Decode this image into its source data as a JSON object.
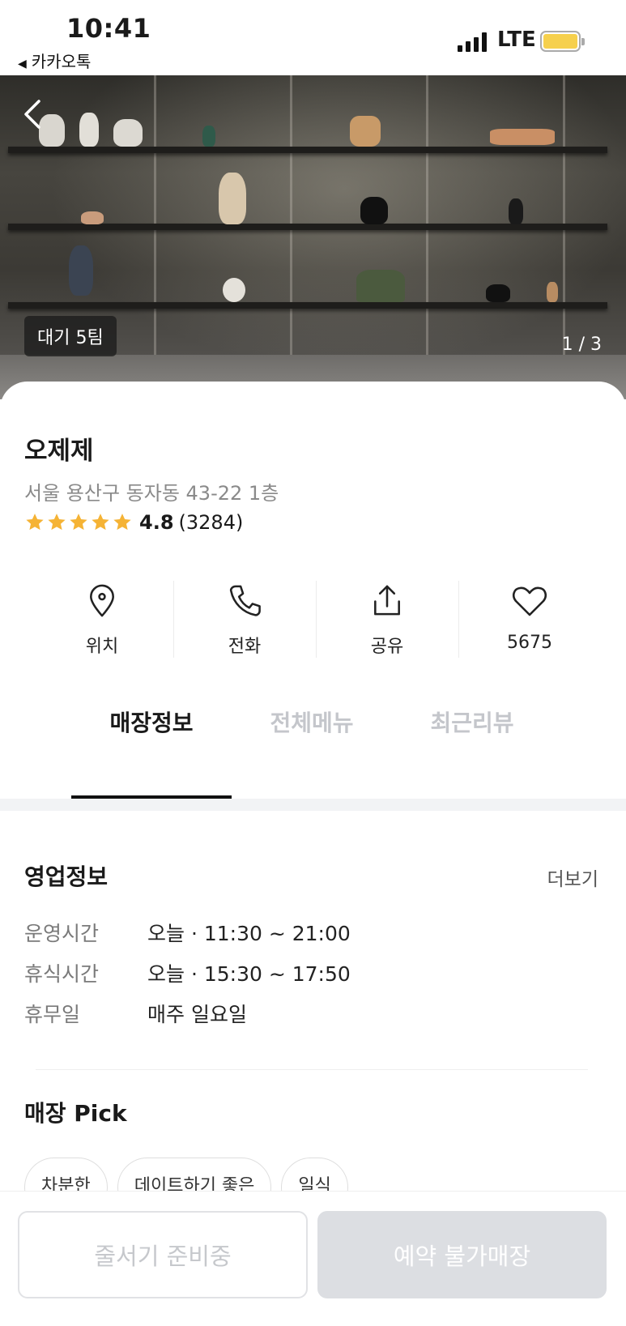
{
  "status_bar": {
    "time": "10:41",
    "back_app": "카카오톡",
    "network": "LTE",
    "battery_color": "#f6d04d"
  },
  "hero": {
    "wait_badge": "대기 5팀",
    "photo_counter": "1 / 3",
    "back_icon": "chevron-left-icon"
  },
  "store": {
    "name": "오제제",
    "address": "서울 용산구 동자동 43-22 1층",
    "rating": "4.8",
    "review_count": "(3284)",
    "stars": 5,
    "star_color": "#f5b335"
  },
  "actions": [
    {
      "label": "위치",
      "icon": "location-pin-icon"
    },
    {
      "label": "전화",
      "icon": "phone-icon"
    },
    {
      "label": "공유",
      "icon": "share-icon"
    },
    {
      "label": "5675",
      "icon": "heart-icon"
    }
  ],
  "tabs": [
    {
      "label": "매장정보",
      "active": true
    },
    {
      "label": "전체메뉴",
      "active": false
    },
    {
      "label": "최근리뷰",
      "active": false
    }
  ],
  "business_info": {
    "title": "영업정보",
    "more": "더보기",
    "rows": [
      {
        "key": "운영시간",
        "value": "오늘 · 11:30 ~ 21:00"
      },
      {
        "key": "휴식시간",
        "value": "오늘 · 15:30 ~ 17:50"
      },
      {
        "key": "휴무일",
        "value": "매주 일요일"
      }
    ]
  },
  "store_pick": {
    "title": "매장 Pick",
    "chips": [
      "차분한",
      "데이트하기 좋은",
      "일식"
    ]
  },
  "bottom": {
    "line_button": "줄서기 준비중",
    "reserve_button": "예약 불가매장"
  }
}
